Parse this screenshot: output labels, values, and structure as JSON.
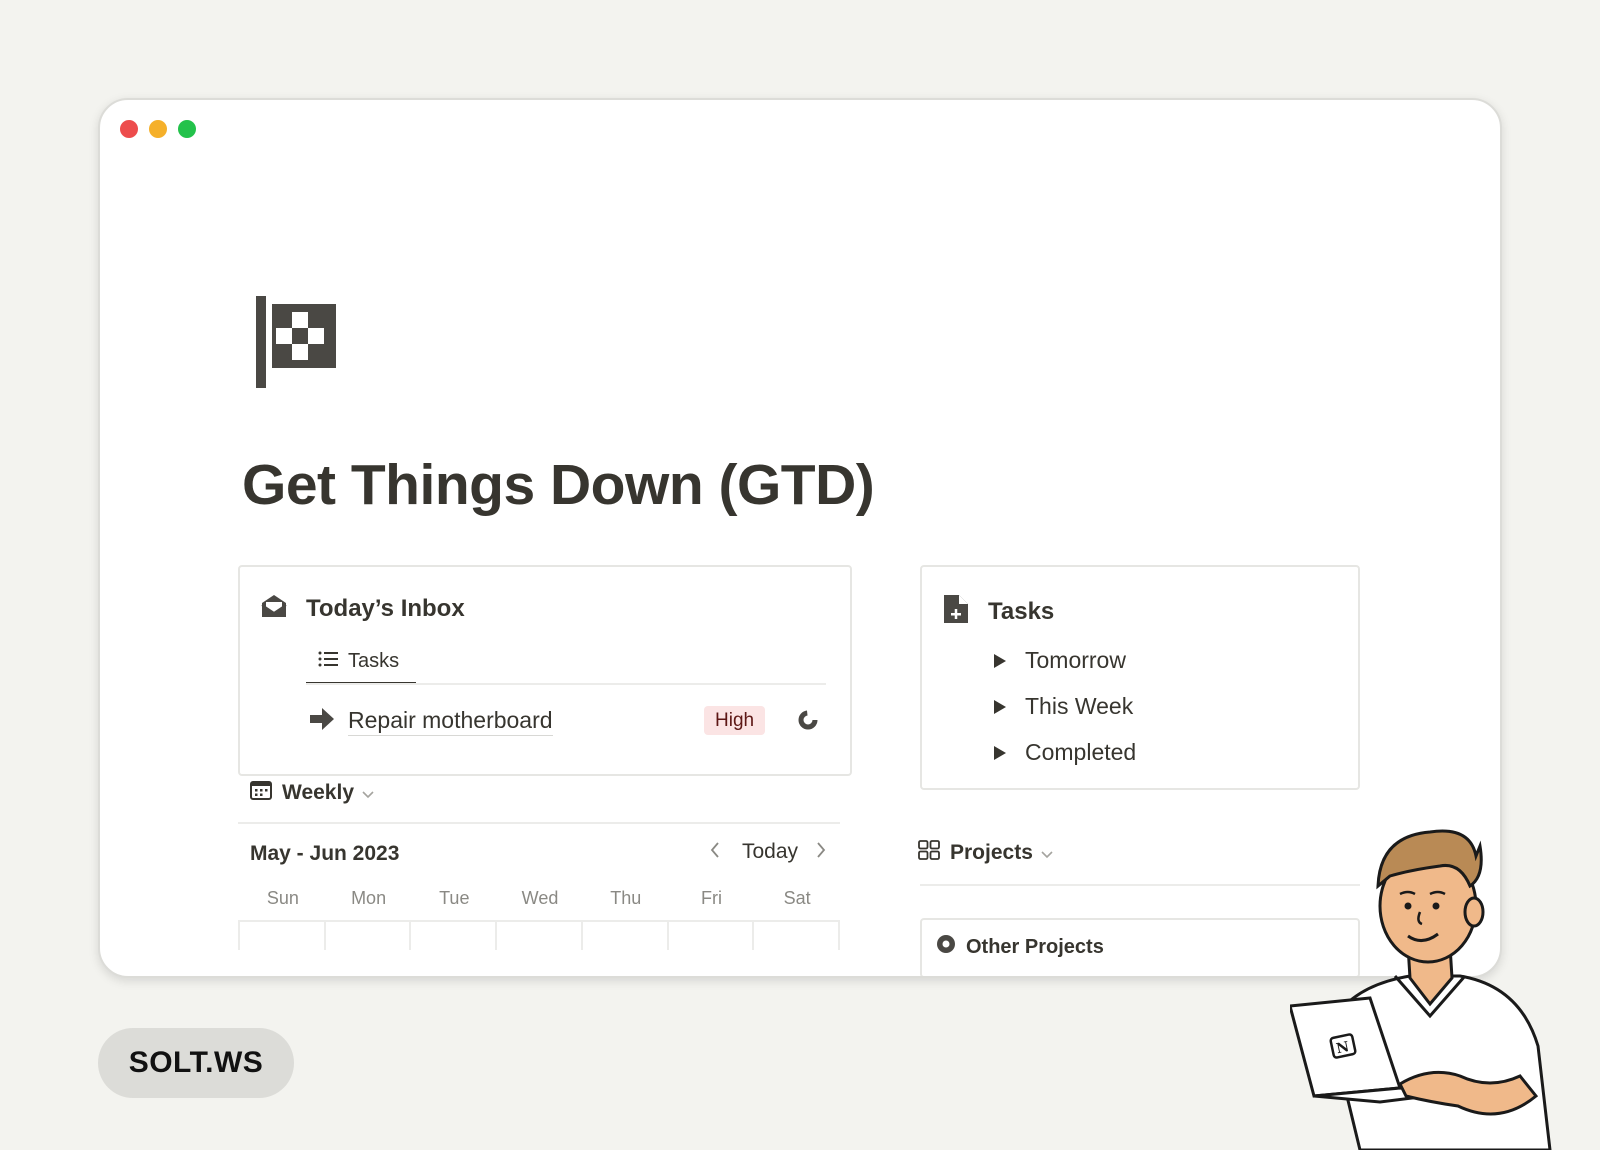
{
  "window": {
    "traffic_lights": [
      {
        "name": "close",
        "color": "#ed4c4c"
      },
      {
        "name": "minimize",
        "color": "#f5b02a"
      },
      {
        "name": "maximize",
        "color": "#23c24b"
      }
    ]
  },
  "page": {
    "icon": "checkered-flag-icon",
    "title": "Get Things Down (GTD)"
  },
  "inbox": {
    "icon": "open-envelope-icon",
    "title": "Today’s Inbox",
    "view_tab": {
      "icon": "list-icon",
      "label": "Tasks"
    },
    "tasks": [
      {
        "icon": "arrow-right-icon",
        "name": "Repair motherboard",
        "priority": "High",
        "priority_color": "#fbe4e4"
      }
    ]
  },
  "tasks_section": {
    "icon": "document-plus-icon",
    "title": "Tasks",
    "toggles": [
      {
        "label": "Tomorrow"
      },
      {
        "label": "This Week"
      },
      {
        "label": "Completed"
      }
    ]
  },
  "calendar": {
    "view": {
      "icon": "calendar-icon",
      "label": "Weekly"
    },
    "month_label": "May - Jun 2023",
    "today_label": "Today",
    "weekdays": [
      "Sun",
      "Mon",
      "Tue",
      "Wed",
      "Thu",
      "Fri",
      "Sat"
    ]
  },
  "projects": {
    "view": {
      "icon": "gallery-icon",
      "label": "Projects"
    },
    "cards": [
      {
        "icon": "circle-icon",
        "label": "Other Projects"
      }
    ]
  },
  "brand": {
    "label": "SOLT.WS"
  },
  "colors": {
    "background": "#f3f3ef",
    "text": "#37352f",
    "muted": "#8a8984",
    "badge_high_bg": "#fbe4e4",
    "badge_high_text": "#5d1715"
  }
}
